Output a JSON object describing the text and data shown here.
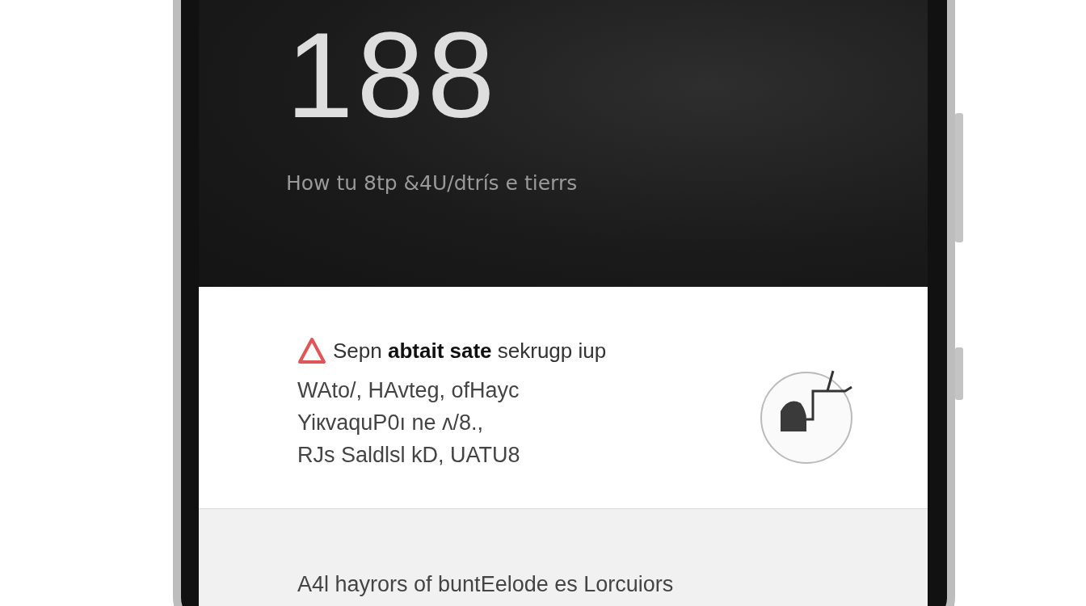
{
  "lock_screen": {
    "time": "188",
    "subtitle": "How tu 8tp &4U/dtrís e tierrs"
  },
  "notification": {
    "title": "Sepn **abtait sate** sekrugp iup",
    "lines": [
      "WAto/, HAvteg, ofHayc",
      "YiкvaquP0ı ne ᴧ/8.,",
      "RJs Saldlsl kD, UATU8"
    ]
  },
  "footer": {
    "text": "A4l hayrors of buntEelode es Lorcuiors"
  }
}
